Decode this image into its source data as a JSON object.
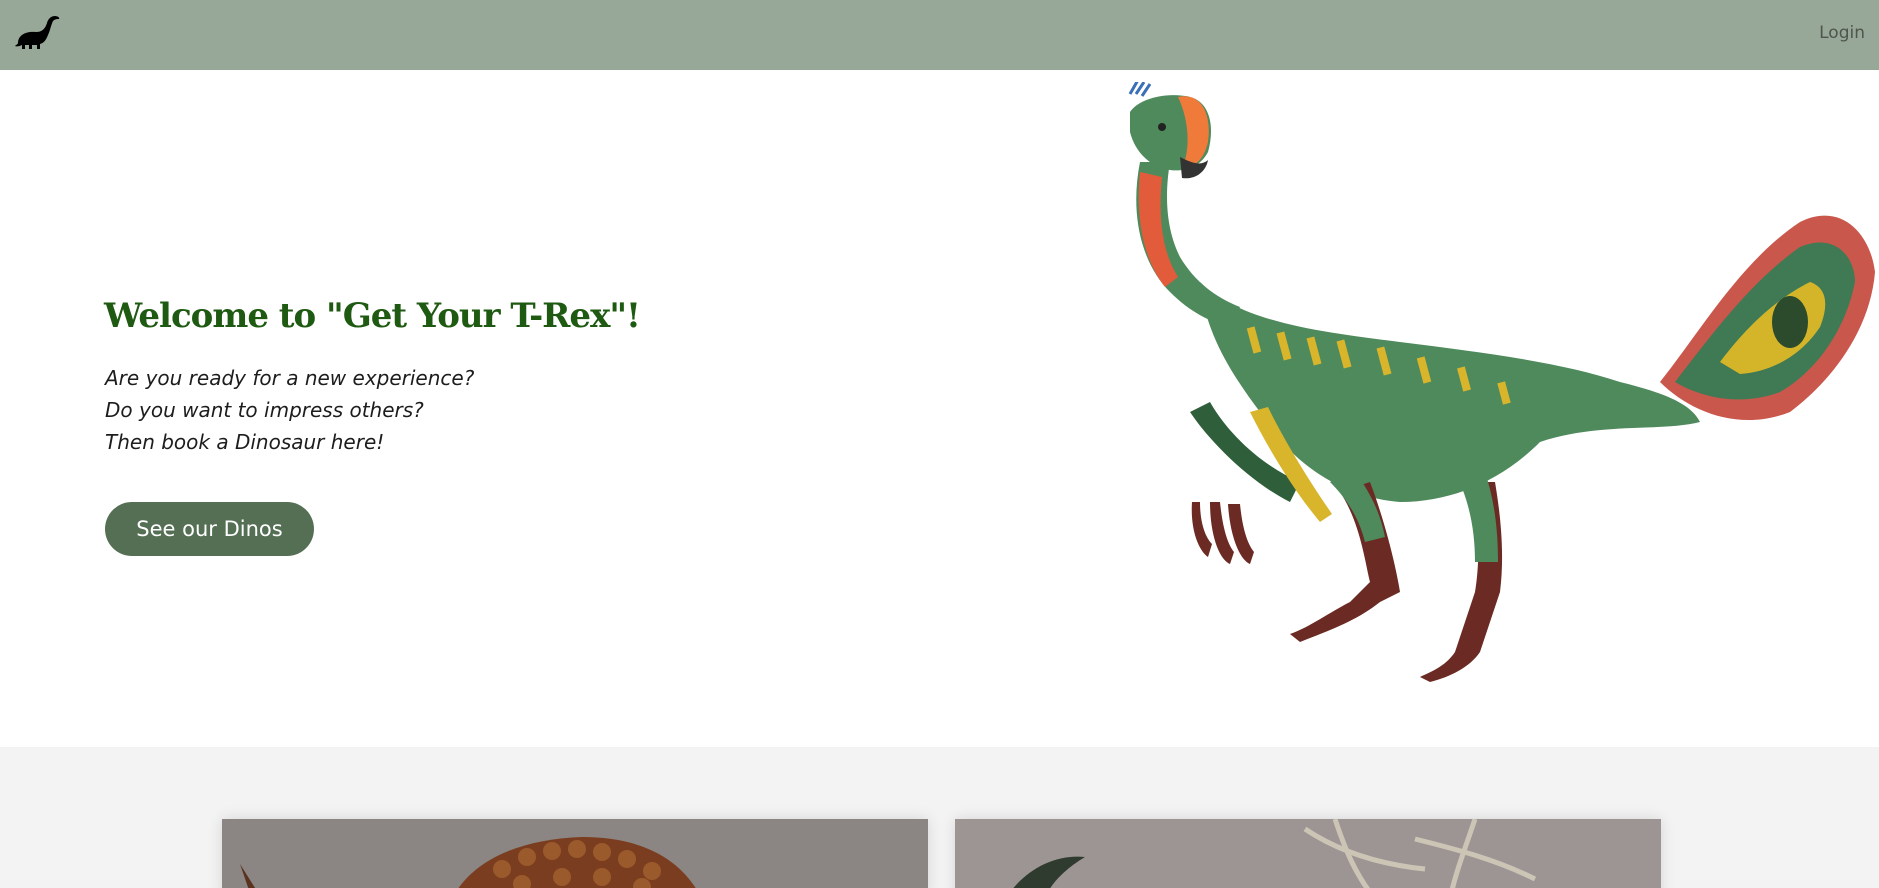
{
  "navbar": {
    "logo_icon": "dinosaur-logo-icon",
    "login_label": "Login",
    "background": "#98a898"
  },
  "hero": {
    "title": "Welcome to \"Get Your T-Rex\"!",
    "lines": [
      "Are you ready for a new experience?",
      "Do you want to impress others?",
      "Then book a Dinosaur here!"
    ],
    "cta_label": "See our Dinos",
    "image_icon": "dinosaur-illustration",
    "title_color": "#1f5a12",
    "cta_color": "#556f55"
  },
  "gallery": {
    "cards": [
      {
        "image_icon": "armored-dinosaur-image"
      },
      {
        "image_icon": "feathered-dinosaur-image"
      }
    ]
  }
}
